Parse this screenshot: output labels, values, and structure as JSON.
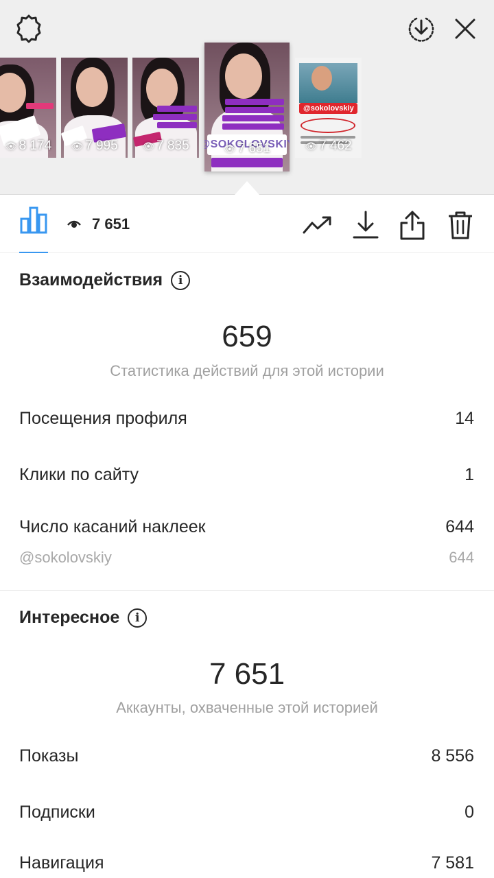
{
  "top": {
    "settings_icon": "gear-icon",
    "download_icon": "download-circle-icon",
    "close_icon": "close-icon",
    "thumbnails": [
      {
        "views": "8 174",
        "selected": false
      },
      {
        "views": "7 995",
        "selected": false
      },
      {
        "views": "7 835",
        "selected": false
      },
      {
        "views": "7 651",
        "selected": true,
        "sticker": "@SOKOLOVSKIY"
      },
      {
        "views": "7 462",
        "selected": false,
        "sticker": "@sokolovskiy"
      }
    ]
  },
  "toolbar": {
    "views_count": "7 651",
    "icons": [
      "bar-chart-icon",
      "eye-icon",
      "trending-icon",
      "download-icon",
      "share-icon",
      "trash-icon"
    ],
    "accent": "#3897f0"
  },
  "interactions": {
    "title": "Взаимодействия",
    "total": "659",
    "caption": "Статистика действий для этой истории",
    "rows": [
      {
        "label": "Посещения профиля",
        "value": "14"
      },
      {
        "label": "Клики по сайту",
        "value": "1"
      },
      {
        "label": "Число касаний наклеек",
        "value": "644"
      }
    ],
    "sub_row": {
      "label": "@sokolovskiy",
      "value": "644"
    }
  },
  "discovery": {
    "title": "Интересное",
    "total": "7 651",
    "caption": "Аккаунты, охваченные этой историей",
    "rows": [
      {
        "label": "Показы",
        "value": "8 556"
      },
      {
        "label": "Подписки",
        "value": "0"
      },
      {
        "label": "Навигация",
        "value": "7 581"
      }
    ]
  }
}
